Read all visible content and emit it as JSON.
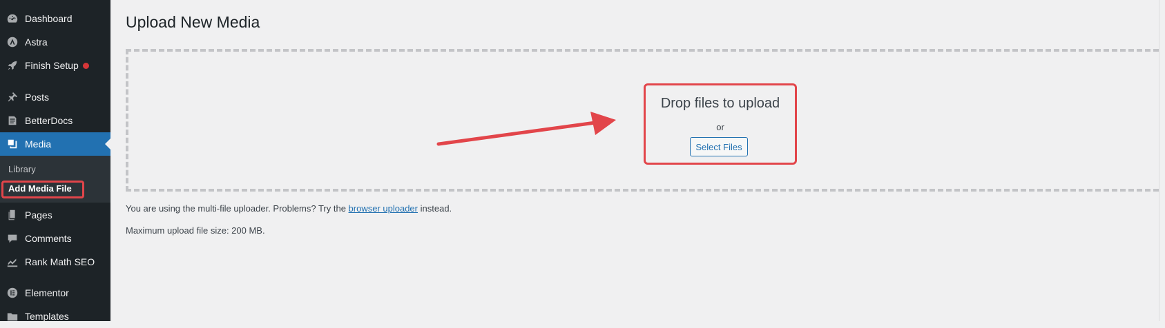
{
  "sidebar": {
    "items": [
      {
        "label": "Dashboard",
        "icon": "dashboard-icon"
      },
      {
        "label": "Astra",
        "icon": "astra-icon"
      },
      {
        "label": "Finish Setup",
        "icon": "rocket-icon"
      },
      {
        "label": "Posts",
        "icon": "pin-icon"
      },
      {
        "label": "BetterDocs",
        "icon": "docs-icon"
      },
      {
        "label": "Media",
        "icon": "media-icon"
      },
      {
        "label": "Pages",
        "icon": "pages-icon"
      },
      {
        "label": "Comments",
        "icon": "comment-icon"
      },
      {
        "label": "Rank Math SEO",
        "icon": "chart-icon"
      },
      {
        "label": "Elementor",
        "icon": "elementor-icon"
      },
      {
        "label": "Templates",
        "icon": "folder-icon"
      }
    ],
    "submenu": {
      "library": "Library",
      "add_media_file": "Add Media File"
    }
  },
  "main": {
    "title": "Upload New Media",
    "drop_title": "Drop files to upload",
    "drop_or": "or",
    "select_files": "Select Files",
    "info_prefix": "You are using the multi-file uploader. Problems? Try the",
    "info_link": "browser uploader",
    "info_suffix": "instead.",
    "max_size": "Maximum upload file size: 200 MB."
  },
  "colors": {
    "sidebar_bg": "#1d2327",
    "active_bg": "#2271b1",
    "highlight": "#e2454a",
    "page_bg": "#f0f0f1"
  }
}
